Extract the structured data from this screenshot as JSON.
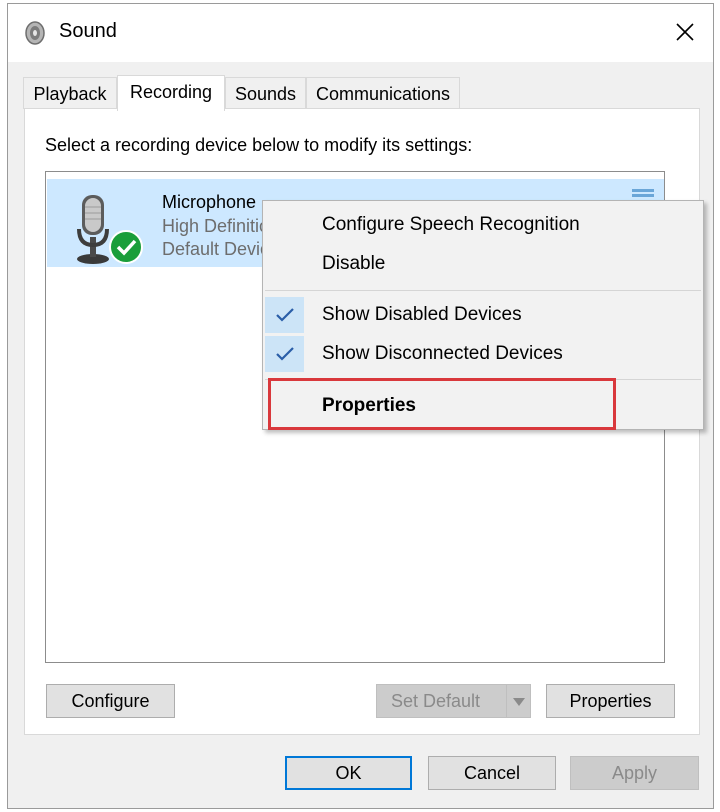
{
  "window": {
    "title": "Sound"
  },
  "tabs": [
    {
      "label": "Playback",
      "active": false
    },
    {
      "label": "Recording",
      "active": true
    },
    {
      "label": "Sounds",
      "active": false
    },
    {
      "label": "Communications",
      "active": false
    }
  ],
  "recording": {
    "instructions": "Select a recording device below to modify its settings:",
    "device": {
      "name": "Microphone",
      "description": "High Definition Audio Device",
      "status": "Default Device",
      "icon": "microphone-icon",
      "badge_icon": "default-check-icon"
    },
    "buttons": {
      "configure": "Configure",
      "set_default": "Set Default",
      "properties": "Properties"
    }
  },
  "context_menu": {
    "items": [
      {
        "label": "Configure Speech Recognition",
        "checked": false
      },
      {
        "label": "Disable",
        "checked": false
      },
      {
        "label": "Show Disabled Devices",
        "checked": true
      },
      {
        "label": "Show Disconnected Devices",
        "checked": true
      },
      {
        "label": "Properties",
        "checked": false,
        "bold": true,
        "highlighted": true
      }
    ]
  },
  "footer": {
    "ok": "OK",
    "cancel": "Cancel",
    "apply": "Apply"
  },
  "colors": {
    "selection": "#cde8ff",
    "check_background": "#cce4f7",
    "highlight_outline": "#d9383c",
    "default_button_border": "#0078d7",
    "status_green": "#1a9e3a"
  }
}
